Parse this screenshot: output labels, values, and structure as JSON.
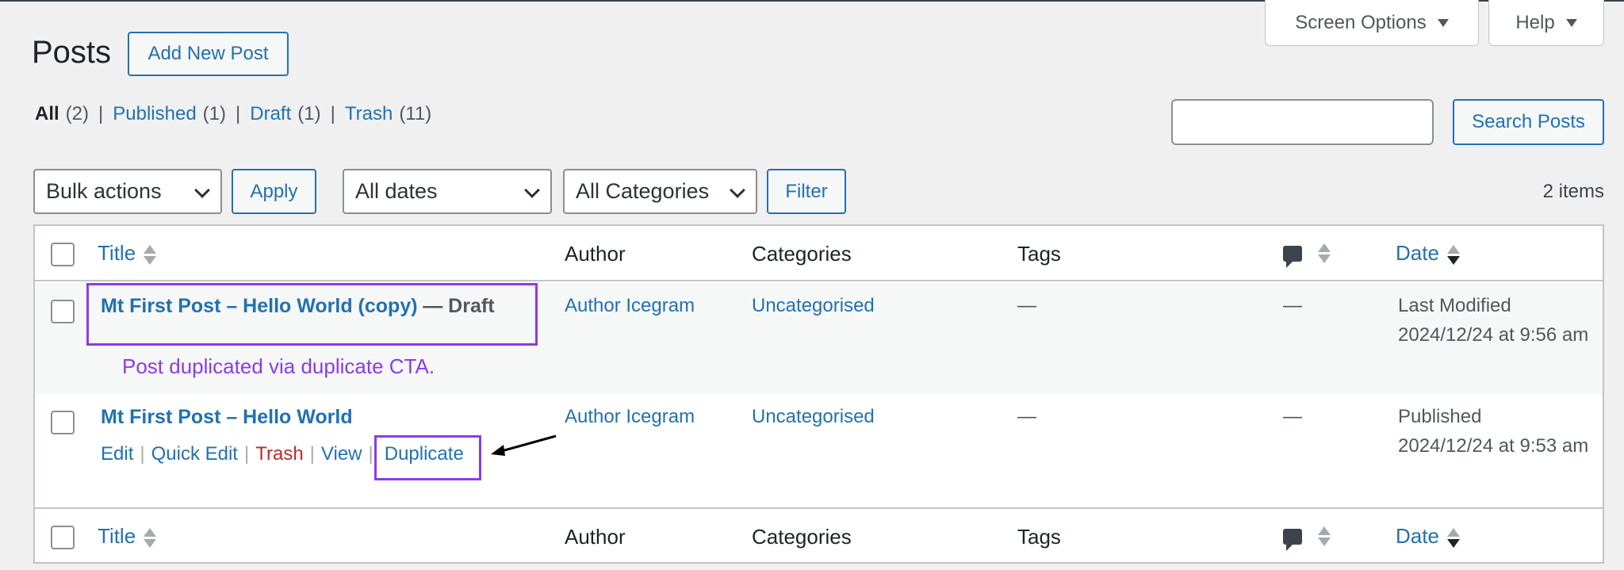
{
  "screen_meta": {
    "screen_options_label": "Screen Options",
    "help_label": "Help"
  },
  "header": {
    "title": "Posts",
    "add_new_label": "Add New Post"
  },
  "views": {
    "all": {
      "label": "All",
      "count": "(2)"
    },
    "published": {
      "label": "Published",
      "count": "(1)"
    },
    "draft": {
      "label": "Draft",
      "count": "(1)"
    },
    "trash": {
      "label": "Trash",
      "count": "(11)"
    },
    "separator": "|"
  },
  "search": {
    "value": "",
    "button_label": "Search Posts"
  },
  "filters": {
    "bulk_actions": "Bulk actions",
    "apply_label": "Apply",
    "dates": "All dates",
    "categories": "All Categories",
    "filter_label": "Filter",
    "items_count": "2 items"
  },
  "table": {
    "columns": {
      "title": "Title",
      "author": "Author",
      "categories": "Categories",
      "tags": "Tags",
      "date": "Date"
    },
    "rows": [
      {
        "title": "Mt First Post – Hello World (copy)",
        "state": "— Draft",
        "author": "Author Icegram",
        "category": "Uncategorised",
        "tags": "—",
        "comments": "—",
        "date_status": "Last Modified",
        "date_value": "2024/12/24 at 9:56 am"
      },
      {
        "title": "Mt First Post – Hello World",
        "state": "",
        "author": "Author Icegram",
        "category": "Uncategorised",
        "tags": "—",
        "comments": "—",
        "date_status": "Published",
        "date_value": "2024/12/24 at 9:53 am",
        "actions": {
          "edit": "Edit",
          "quick_edit": "Quick Edit",
          "trash": "Trash",
          "view": "View",
          "duplicate": "Duplicate",
          "separator": "|"
        }
      }
    ]
  },
  "annotation": {
    "note": "Post duplicated via duplicate CTA.",
    "color": "#8c3ce6"
  },
  "colors": {
    "link": "#2271b1",
    "trash": "#b32d2e",
    "background": "#f0f0f1"
  }
}
